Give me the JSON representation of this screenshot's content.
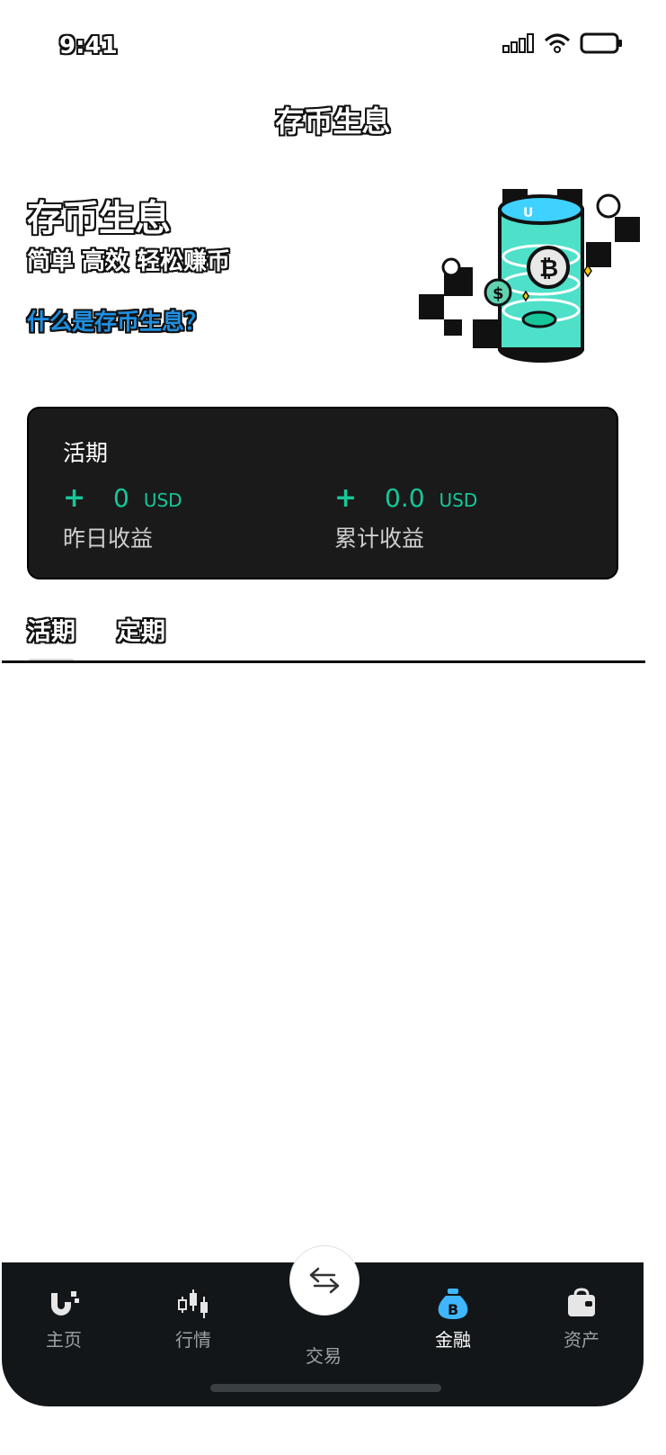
{
  "status_bar": {
    "time": "9:41"
  },
  "header": {
    "title": "存币生息"
  },
  "hero": {
    "title": "存币生息",
    "subtitle": "简单 高效 轻松赚币",
    "link": "什么是存币生息？"
  },
  "card": {
    "title": "活期",
    "stats": [
      {
        "sign": "+",
        "value": "0",
        "unit": "USD",
        "label": "昨日收益"
      },
      {
        "sign": "+",
        "value": "0.0",
        "unit": "USD",
        "label": "累计收益"
      }
    ]
  },
  "tabs": [
    {
      "label": "活期",
      "active": true
    },
    {
      "label": "定期",
      "active": false
    }
  ],
  "bottom_nav": [
    {
      "label": "主页",
      "icon": "home-logo-icon"
    },
    {
      "label": "行情",
      "icon": "candlestick-icon"
    },
    {
      "label": "交易",
      "icon": "swap-icon"
    },
    {
      "label": "金融",
      "icon": "money-bag-icon",
      "active": true
    },
    {
      "label": "资产",
      "icon": "wallet-bag-icon"
    }
  ],
  "colors": {
    "accent_green": "#16c79a",
    "link_blue": "#1f8fe0",
    "card_bg": "#1a1a1a",
    "nav_bg": "#121618"
  }
}
